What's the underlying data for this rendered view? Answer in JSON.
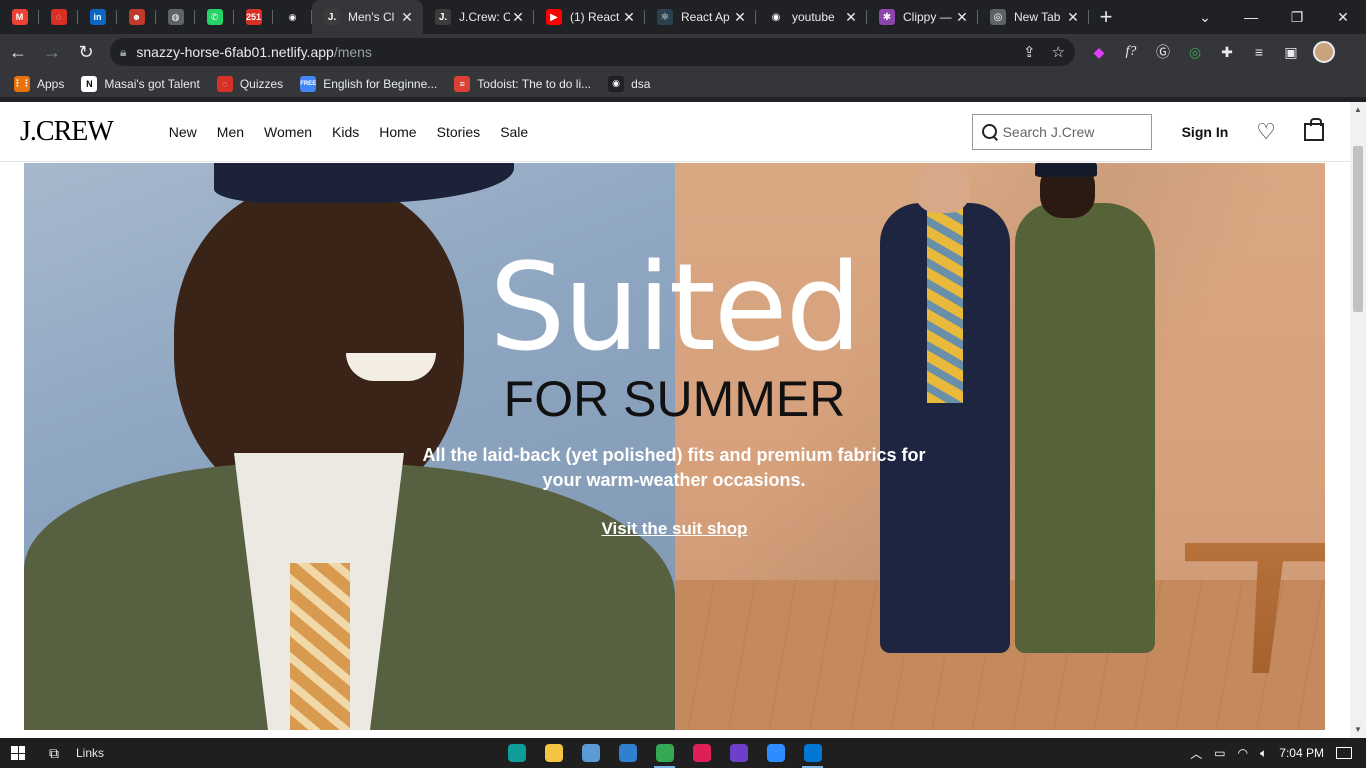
{
  "browser": {
    "pinned_tabs": [
      {
        "icon": "gmail-icon",
        "color": "#ea4335",
        "glyph": "M"
      },
      {
        "icon": "circle-app-icon",
        "color": "#d93025",
        "glyph": "◌"
      },
      {
        "icon": "linkedin-icon",
        "color": "#0a66c2",
        "glyph": "in"
      },
      {
        "icon": "bitmoji-icon",
        "color": "#c0392b",
        "glyph": "☻"
      },
      {
        "icon": "globe-icon",
        "color": "#5f6368",
        "glyph": "◍"
      },
      {
        "icon": "whatsapp-icon",
        "color": "#25d366",
        "glyph": "✆"
      },
      {
        "icon": "badge-251-icon",
        "color": "#d93025",
        "glyph": "251"
      },
      {
        "icon": "github-icon",
        "color": "#202124",
        "glyph": "◉"
      }
    ],
    "tabs": [
      {
        "title": "Men's Cl",
        "icon": "jcrew-icon",
        "color": "#3c3c3c",
        "glyph": "J.",
        "active": true
      },
      {
        "title": "J.Crew: C",
        "icon": "jcrew-icon",
        "color": "#3c3c3c",
        "glyph": "J.",
        "active": false
      },
      {
        "title": "(1) React",
        "icon": "youtube-icon",
        "color": "#ff0000",
        "glyph": "▶",
        "active": false
      },
      {
        "title": "React Ap",
        "icon": "react-icon",
        "color": "#2b4150",
        "glyph": "⚛",
        "active": false
      },
      {
        "title": "youtube",
        "icon": "github-icon",
        "color": "#202124",
        "glyph": "◉",
        "active": false
      },
      {
        "title": "Clippy —",
        "icon": "clippy-icon",
        "color": "#8e44ad",
        "glyph": "✱",
        "active": false
      },
      {
        "title": "New Tab",
        "icon": "chrome-icon",
        "color": "#5f6368",
        "glyph": "◎",
        "active": false
      }
    ],
    "new_tab_label": "+",
    "window_controls": {
      "dropdown": "⌄",
      "minimize": "—",
      "restore": "❐",
      "close": "✕"
    },
    "url_host": "snazzy-horse-6fab01.netlify.app",
    "url_path": "/mens",
    "bookmarks": [
      {
        "label": "Apps",
        "icon": "apps-grid-icon",
        "color": "#e8710a",
        "glyph": "⋮⋮"
      },
      {
        "label": "Masai's got Talent",
        "icon": "notion-icon",
        "color": "#ffffff",
        "glyph": "N"
      },
      {
        "label": "Quizzes",
        "icon": "quiz-icon",
        "color": "#d93025",
        "glyph": "◌"
      },
      {
        "label": "English for Beginne...",
        "icon": "free-badge-icon",
        "color": "#4285f4",
        "glyph": "FREE"
      },
      {
        "label": "Todoist: The to do li...",
        "icon": "todoist-icon",
        "color": "#db4035",
        "glyph": "≡"
      },
      {
        "label": "dsa",
        "icon": "github-icon",
        "color": "#202124",
        "glyph": "◉"
      }
    ]
  },
  "site": {
    "logo": "J.CREW",
    "nav": [
      "New",
      "Men",
      "Women",
      "Kids",
      "Home",
      "Stories",
      "Sale"
    ],
    "search_placeholder": "Search J.Crew",
    "sign_in": "Sign In"
  },
  "hero": {
    "headline": "Suited",
    "subheadline": "FOR SUMMER",
    "blurb": "All the laid-back (yet polished) fits and premium fabrics for your warm-weather occasions.",
    "cta": "Visit the suit shop"
  },
  "taskbar": {
    "links_label": "Links",
    "apps": [
      {
        "icon": "edge-icon",
        "color": "#0f9d9a",
        "running": false
      },
      {
        "icon": "file-explorer-icon",
        "color": "#f4c542",
        "running": false
      },
      {
        "icon": "calculator-icon",
        "color": "#5b9bd5",
        "running": false
      },
      {
        "icon": "mail-icon",
        "color": "#2f80d1",
        "running": false
      },
      {
        "icon": "chrome-icon",
        "color": "#34a853",
        "running": true
      },
      {
        "icon": "slack-icon",
        "color": "#e01e5a",
        "running": false
      },
      {
        "icon": "github-desktop-icon",
        "color": "#6e40c9",
        "running": false
      },
      {
        "icon": "zoom-icon",
        "color": "#2d8cff",
        "running": false
      },
      {
        "icon": "vscode-icon",
        "color": "#0078d4",
        "running": true
      }
    ],
    "clock": "7:04 PM"
  }
}
